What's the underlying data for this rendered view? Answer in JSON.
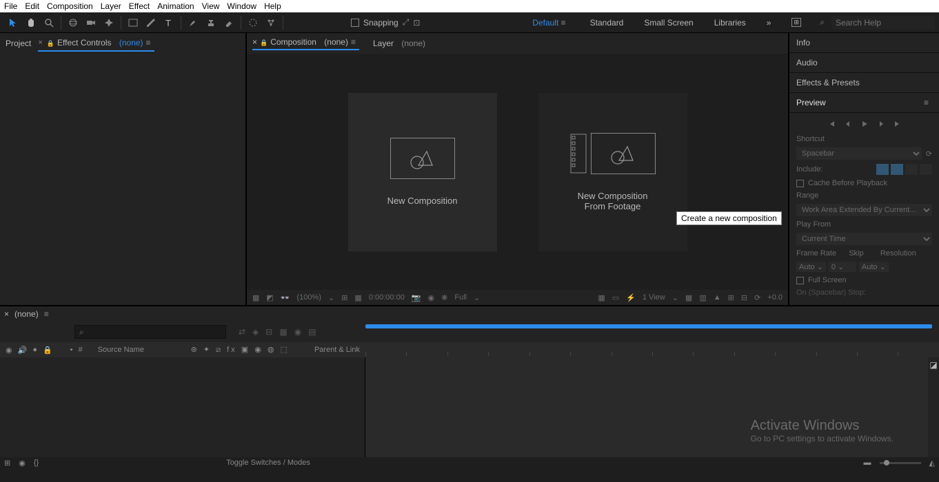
{
  "menubar": [
    "File",
    "Edit",
    "Composition",
    "Layer",
    "Effect",
    "Animation",
    "View",
    "Window",
    "Help"
  ],
  "toolbar": {
    "snapping_label": "Snapping",
    "workspaces": {
      "default": "Default",
      "standard": "Standard",
      "small": "Small Screen",
      "libraries": "Libraries"
    },
    "search_placeholder": "Search Help"
  },
  "left_tabs": {
    "project": "Project",
    "effect_controls": "Effect Controls",
    "none": "(none)"
  },
  "center_tabs": {
    "composition": "Composition",
    "none": "(none)",
    "layer": "Layer",
    "layer_none": "(none)"
  },
  "comp_area": {
    "new_comp": "New Composition",
    "from_footage_l1": "New Composition",
    "from_footage_l2": "From Footage",
    "tooltip": "Create a new composition"
  },
  "viewer_footer": {
    "zoom": "(100%)",
    "time": "0:00:00:00",
    "res": "Full",
    "view": "1 View",
    "exposure": "+0.0"
  },
  "right": {
    "info": "Info",
    "audio": "Audio",
    "effects": "Effects & Presets",
    "preview": "Preview",
    "shortcut_label": "Shortcut",
    "shortcut_val": "Spacebar",
    "include": "Include:",
    "cache": "Cache Before Playback",
    "range": "Range",
    "range_val": "Work Area Extended By Current...",
    "play_from": "Play From",
    "play_from_val": "Current Time",
    "frame_rate": "Frame Rate",
    "skip": "Skip",
    "resolution": "Resolution",
    "auto": "Auto",
    "zero": "0",
    "full_screen": "Full Screen",
    "on_stop": "On (Spacebar) Stop:"
  },
  "timeline": {
    "tab": "(none)",
    "placeholder_icon": "⌕",
    "head": {
      "num": "#",
      "source": "Source Name",
      "parent": "Parent & Link"
    },
    "footer_toggle": "Toggle Switches / Modes"
  },
  "watermark": {
    "title": "Activate Windows",
    "sub": "Go to PC settings to activate Windows."
  }
}
